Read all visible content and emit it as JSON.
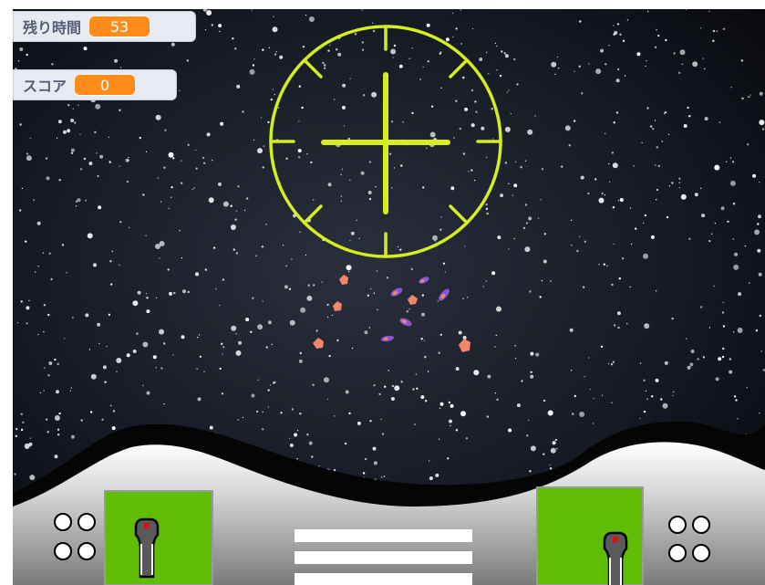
{
  "monitors": {
    "time": {
      "label": "残り時間",
      "value": "53"
    },
    "score": {
      "label": "スコア",
      "value": "0"
    }
  },
  "colors": {
    "reticle": "#d4ee1f",
    "screen": "#5fbd06",
    "monitor_value_bg": "#ff8c1a",
    "monitor_bg": "#e6eaf1",
    "space": "#0e1118",
    "asteroid": "#f2866b",
    "enemy_ship": "#8a56d6"
  },
  "icons": {
    "joystick": "joystick-icon",
    "crosshair": "crosshair-icon",
    "indicator_lights": "indicator-lights-icon"
  }
}
